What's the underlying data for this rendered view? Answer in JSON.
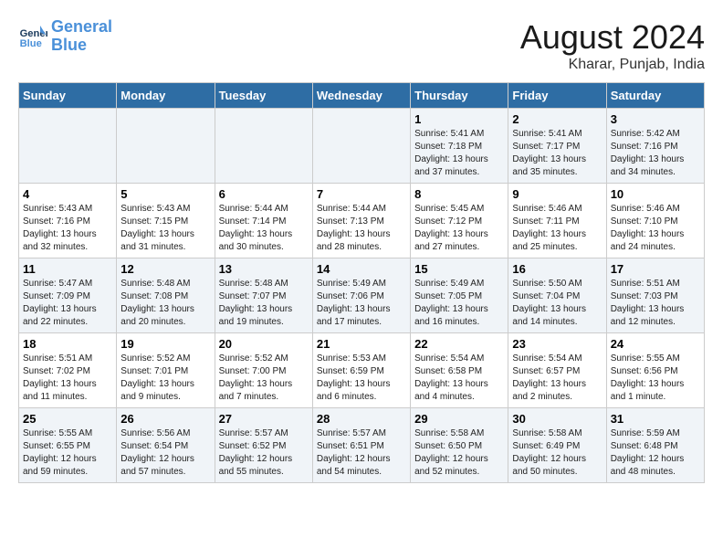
{
  "header": {
    "logo_general": "General",
    "logo_blue": "Blue",
    "month_year": "August 2024",
    "location": "Kharar, Punjab, India"
  },
  "weekdays": [
    "Sunday",
    "Monday",
    "Tuesday",
    "Wednesday",
    "Thursday",
    "Friday",
    "Saturday"
  ],
  "weeks": [
    [
      {
        "day": "",
        "info": ""
      },
      {
        "day": "",
        "info": ""
      },
      {
        "day": "",
        "info": ""
      },
      {
        "day": "",
        "info": ""
      },
      {
        "day": "1",
        "info": "Sunrise: 5:41 AM\nSunset: 7:18 PM\nDaylight: 13 hours\nand 37 minutes."
      },
      {
        "day": "2",
        "info": "Sunrise: 5:41 AM\nSunset: 7:17 PM\nDaylight: 13 hours\nand 35 minutes."
      },
      {
        "day": "3",
        "info": "Sunrise: 5:42 AM\nSunset: 7:16 PM\nDaylight: 13 hours\nand 34 minutes."
      }
    ],
    [
      {
        "day": "4",
        "info": "Sunrise: 5:43 AM\nSunset: 7:16 PM\nDaylight: 13 hours\nand 32 minutes."
      },
      {
        "day": "5",
        "info": "Sunrise: 5:43 AM\nSunset: 7:15 PM\nDaylight: 13 hours\nand 31 minutes."
      },
      {
        "day": "6",
        "info": "Sunrise: 5:44 AM\nSunset: 7:14 PM\nDaylight: 13 hours\nand 30 minutes."
      },
      {
        "day": "7",
        "info": "Sunrise: 5:44 AM\nSunset: 7:13 PM\nDaylight: 13 hours\nand 28 minutes."
      },
      {
        "day": "8",
        "info": "Sunrise: 5:45 AM\nSunset: 7:12 PM\nDaylight: 13 hours\nand 27 minutes."
      },
      {
        "day": "9",
        "info": "Sunrise: 5:46 AM\nSunset: 7:11 PM\nDaylight: 13 hours\nand 25 minutes."
      },
      {
        "day": "10",
        "info": "Sunrise: 5:46 AM\nSunset: 7:10 PM\nDaylight: 13 hours\nand 24 minutes."
      }
    ],
    [
      {
        "day": "11",
        "info": "Sunrise: 5:47 AM\nSunset: 7:09 PM\nDaylight: 13 hours\nand 22 minutes."
      },
      {
        "day": "12",
        "info": "Sunrise: 5:48 AM\nSunset: 7:08 PM\nDaylight: 13 hours\nand 20 minutes."
      },
      {
        "day": "13",
        "info": "Sunrise: 5:48 AM\nSunset: 7:07 PM\nDaylight: 13 hours\nand 19 minutes."
      },
      {
        "day": "14",
        "info": "Sunrise: 5:49 AM\nSunset: 7:06 PM\nDaylight: 13 hours\nand 17 minutes."
      },
      {
        "day": "15",
        "info": "Sunrise: 5:49 AM\nSunset: 7:05 PM\nDaylight: 13 hours\nand 16 minutes."
      },
      {
        "day": "16",
        "info": "Sunrise: 5:50 AM\nSunset: 7:04 PM\nDaylight: 13 hours\nand 14 minutes."
      },
      {
        "day": "17",
        "info": "Sunrise: 5:51 AM\nSunset: 7:03 PM\nDaylight: 13 hours\nand 12 minutes."
      }
    ],
    [
      {
        "day": "18",
        "info": "Sunrise: 5:51 AM\nSunset: 7:02 PM\nDaylight: 13 hours\nand 11 minutes."
      },
      {
        "day": "19",
        "info": "Sunrise: 5:52 AM\nSunset: 7:01 PM\nDaylight: 13 hours\nand 9 minutes."
      },
      {
        "day": "20",
        "info": "Sunrise: 5:52 AM\nSunset: 7:00 PM\nDaylight: 13 hours\nand 7 minutes."
      },
      {
        "day": "21",
        "info": "Sunrise: 5:53 AM\nSunset: 6:59 PM\nDaylight: 13 hours\nand 6 minutes."
      },
      {
        "day": "22",
        "info": "Sunrise: 5:54 AM\nSunset: 6:58 PM\nDaylight: 13 hours\nand 4 minutes."
      },
      {
        "day": "23",
        "info": "Sunrise: 5:54 AM\nSunset: 6:57 PM\nDaylight: 13 hours\nand 2 minutes."
      },
      {
        "day": "24",
        "info": "Sunrise: 5:55 AM\nSunset: 6:56 PM\nDaylight: 13 hours\nand 1 minute."
      }
    ],
    [
      {
        "day": "25",
        "info": "Sunrise: 5:55 AM\nSunset: 6:55 PM\nDaylight: 12 hours\nand 59 minutes."
      },
      {
        "day": "26",
        "info": "Sunrise: 5:56 AM\nSunset: 6:54 PM\nDaylight: 12 hours\nand 57 minutes."
      },
      {
        "day": "27",
        "info": "Sunrise: 5:57 AM\nSunset: 6:52 PM\nDaylight: 12 hours\nand 55 minutes."
      },
      {
        "day": "28",
        "info": "Sunrise: 5:57 AM\nSunset: 6:51 PM\nDaylight: 12 hours\nand 54 minutes."
      },
      {
        "day": "29",
        "info": "Sunrise: 5:58 AM\nSunset: 6:50 PM\nDaylight: 12 hours\nand 52 minutes."
      },
      {
        "day": "30",
        "info": "Sunrise: 5:58 AM\nSunset: 6:49 PM\nDaylight: 12 hours\nand 50 minutes."
      },
      {
        "day": "31",
        "info": "Sunrise: 5:59 AM\nSunset: 6:48 PM\nDaylight: 12 hours\nand 48 minutes."
      }
    ]
  ]
}
